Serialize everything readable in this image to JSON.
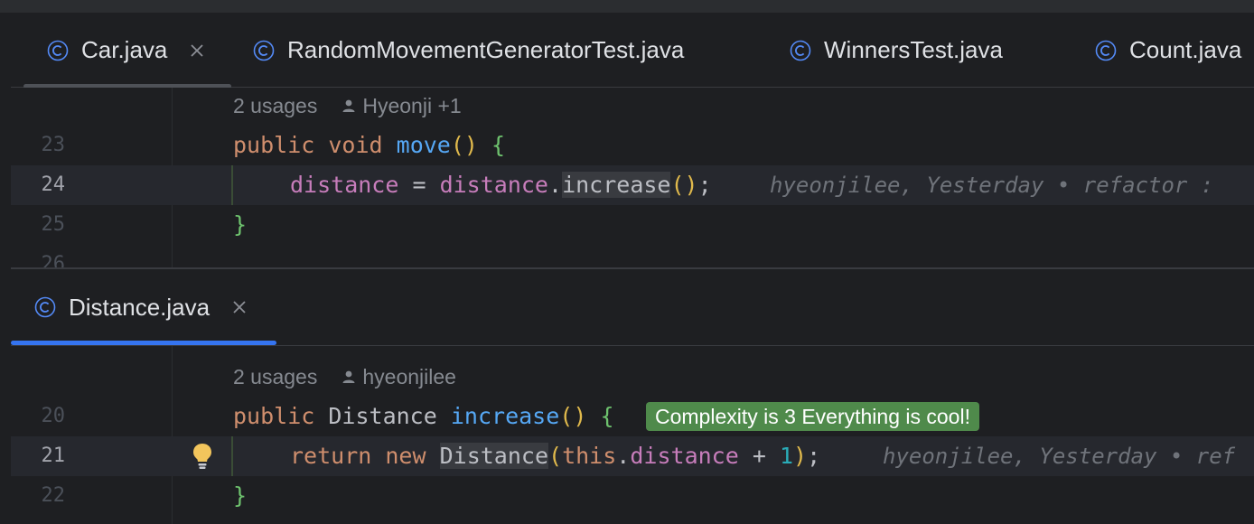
{
  "colors": {
    "accent": "#3574f0",
    "inactive_underline": "#4e5157",
    "badge_bg": "#4f8a4b"
  },
  "top_tabs": [
    {
      "label": "Car.java",
      "icon": "class-icon",
      "closable": true,
      "active": true
    },
    {
      "label": "RandomMovementGeneratorTest.java",
      "icon": "class-icon",
      "closable": false,
      "active": false
    },
    {
      "label": "WinnersTest.java",
      "icon": "class-icon",
      "closable": false,
      "active": false
    },
    {
      "label": "Count.java",
      "icon": "class-icon",
      "closable": false,
      "active": false
    }
  ],
  "top_editor": {
    "usages": "2 usages",
    "author": "Hyeonji +1",
    "lines": {
      "l23": {
        "number": "23"
      },
      "l24": {
        "number": "24"
      },
      "l25": {
        "number": "25"
      },
      "l26": {
        "number": "26"
      }
    },
    "blame": "hyeonjilee, Yesterday • refactor :"
  },
  "bottom_tab": {
    "label": "Distance.java",
    "icon": "class-icon",
    "closable": true,
    "active": true
  },
  "bottom_editor": {
    "usages": "2 usages",
    "author": "hyeonjilee",
    "lines": {
      "l20": {
        "number": "20"
      },
      "l21": {
        "number": "21"
      },
      "l22": {
        "number": "22"
      }
    },
    "complexity_badge": "Complexity is 3 Everything is cool!",
    "blame": "hyeonjilee, Yesterday • ref"
  },
  "code": {
    "public": "public",
    "void": "void",
    "move": "move",
    "distance": "distance",
    "increase": "increase",
    "Distance": "Distance",
    "return": "return",
    "new": "new",
    "this": "this",
    "one": "1"
  }
}
